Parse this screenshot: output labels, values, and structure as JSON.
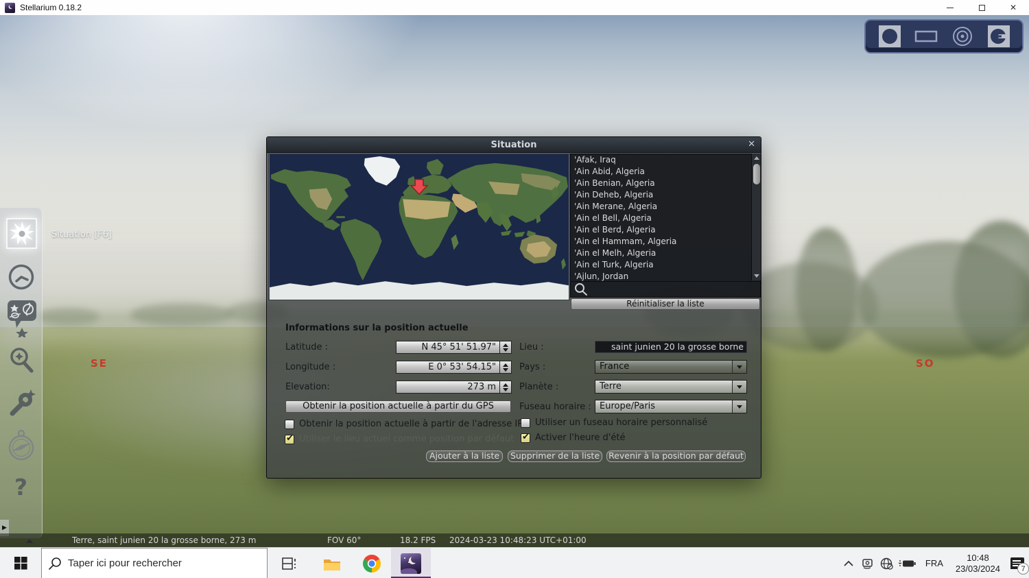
{
  "window": {
    "title": "Stellarium 0.18.2"
  },
  "scene": {
    "compass_se": "SE",
    "compass_so": "SO"
  },
  "sidebar": {
    "tooltip": "Situation  [F6]",
    "icon_names": [
      "location-starburst",
      "clock",
      "sky-viewing-options",
      "search-magnifier",
      "configuration-wrench",
      "astronomical-compass",
      "help-question"
    ]
  },
  "corner_toolbar_icons": [
    "circle-toggle",
    "rectangle-toggle",
    "target-toggle",
    "socket-toggle"
  ],
  "dialog": {
    "title": "Situation",
    "close_icon": "✕",
    "cities": [
      "'Afak, Iraq",
      "'Ain Abid, Algeria",
      "'Ain Benian, Algeria",
      "'Ain Deheb, Algeria",
      "'Ain Merane, Algeria",
      "'Ain el Bell, Algeria",
      "'Ain el Berd, Algeria",
      "'Ain el Hammam, Algeria",
      "'Ain el Melh, Algeria",
      "'Ain el Turk, Algeria",
      "'Ajlun, Jordan"
    ],
    "reset_list_button": "Réinitialiser la liste",
    "section_title": "Informations sur la position actuelle",
    "fields": {
      "latitude_label": "Latitude :",
      "latitude_value": "N 45° 51' 51.97\"",
      "longitude_label": "Longitude :",
      "longitude_value": "E 0° 53' 54.15\"",
      "elevation_label": "Elevation:",
      "elevation_value": "273 m",
      "lieu_label": "Lieu :",
      "lieu_value": "saint junien 20 la grosse borne",
      "pays_label": "Pays :",
      "pays_value": "France",
      "planete_label": "Planète :",
      "planete_value": "Terre",
      "fuseau_label": "Fuseau horaire :",
      "fuseau_value": "Europe/Paris"
    },
    "gps_button": "Obtenir la position actuelle à partir du GPS",
    "checkboxes": {
      "ip": {
        "label": "Obtenir la position actuelle à partir de l'adresse IP",
        "checked": false
      },
      "default_location": {
        "label": "Utiliser le lieu actuel comme position par défaut",
        "checked": true
      },
      "custom_timezone": {
        "label": "Utiliser un fuseau horaire personnalisé",
        "checked": false
      },
      "dst": {
        "label": "Activer l'heure d'été",
        "checked": true
      }
    },
    "action_buttons": {
      "add": "Ajouter à la liste",
      "remove": "Supprimer de la liste",
      "revert": "Revenir à la position par défaut"
    }
  },
  "statusbar": {
    "location": "Terre, saint junien 20 la grosse borne, 273 m",
    "fov": "FOV 60°",
    "fps": "18.2 FPS",
    "datetime": "2024-03-23 10:48:23 UTC+01:00"
  },
  "taskbar": {
    "search_placeholder": "Taper ici pour rechercher",
    "language": "FRA",
    "time": "10:48",
    "date": "23/03/2024",
    "notification_count": "7"
  }
}
